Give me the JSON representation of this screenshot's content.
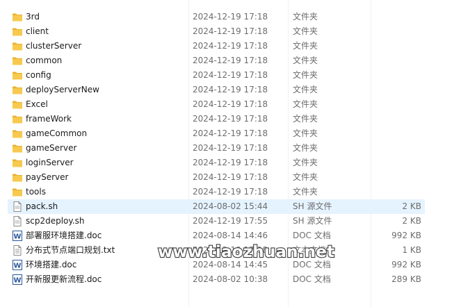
{
  "files": [
    {
      "name": "3rd",
      "date": "2024-12-19 17:18",
      "type": "文件夹",
      "size": "",
      "icon": "folder-icon"
    },
    {
      "name": "client",
      "date": "2024-12-19 17:18",
      "type": "文件夹",
      "size": "",
      "icon": "folder-icon"
    },
    {
      "name": "clusterServer",
      "date": "2024-12-19 17:18",
      "type": "文件夹",
      "size": "",
      "icon": "folder-icon"
    },
    {
      "name": "common",
      "date": "2024-12-19 17:18",
      "type": "文件夹",
      "size": "",
      "icon": "folder-icon"
    },
    {
      "name": "config",
      "date": "2024-12-19 17:18",
      "type": "文件夹",
      "size": "",
      "icon": "folder-icon"
    },
    {
      "name": "deployServerNew",
      "date": "2024-12-19 17:18",
      "type": "文件夹",
      "size": "",
      "icon": "folder-icon"
    },
    {
      "name": "Excel",
      "date": "2024-12-19 17:18",
      "type": "文件夹",
      "size": "",
      "icon": "folder-icon"
    },
    {
      "name": "frameWork",
      "date": "2024-12-19 17:18",
      "type": "文件夹",
      "size": "",
      "icon": "folder-icon"
    },
    {
      "name": "gameCommon",
      "date": "2024-12-19 17:18",
      "type": "文件夹",
      "size": "",
      "icon": "folder-icon"
    },
    {
      "name": "gameServer",
      "date": "2024-12-19 17:18",
      "type": "文件夹",
      "size": "",
      "icon": "folder-icon"
    },
    {
      "name": "loginServer",
      "date": "2024-12-19 17:18",
      "type": "文件夹",
      "size": "",
      "icon": "folder-icon"
    },
    {
      "name": "payServer",
      "date": "2024-12-19 17:18",
      "type": "文件夹",
      "size": "",
      "icon": "folder-icon"
    },
    {
      "name": "tools",
      "date": "2024-12-19 17:18",
      "type": "文件夹",
      "size": "",
      "icon": "folder-icon"
    },
    {
      "name": "pack.sh",
      "date": "2024-08-02 15:44",
      "type": "SH 源文件",
      "size": "2 KB",
      "icon": "script-file-icon",
      "selected": true
    },
    {
      "name": "scp2deploy.sh",
      "date": "2024-12-19 17:55",
      "type": "SH 源文件",
      "size": "2 KB",
      "icon": "script-file-icon"
    },
    {
      "name": "部署服环境搭建.doc",
      "date": "2024-08-14 14:46",
      "type": "DOC 文档",
      "size": "992 KB",
      "icon": "word-doc-icon"
    },
    {
      "name": "分布式节点端口规划.txt",
      "date": "2024-12-19 17:18",
      "type": "文本文档",
      "size": "1 KB",
      "icon": "text-file-icon"
    },
    {
      "name": "环境搭建.doc",
      "date": "2024-08-14 14:45",
      "type": "DOC 文档",
      "size": "992 KB",
      "icon": "word-doc-icon"
    },
    {
      "name": "开新服更新流程.doc",
      "date": "2024-08-02 10:38",
      "type": "DOC 文档",
      "size": "289 KB",
      "icon": "word-doc-icon"
    }
  ],
  "watermark": "www.tiaozhuan.net",
  "colors": {
    "selected_bg": "#e5f3ff",
    "folder": "#f7c34a",
    "word_blue": "#2b579a"
  }
}
